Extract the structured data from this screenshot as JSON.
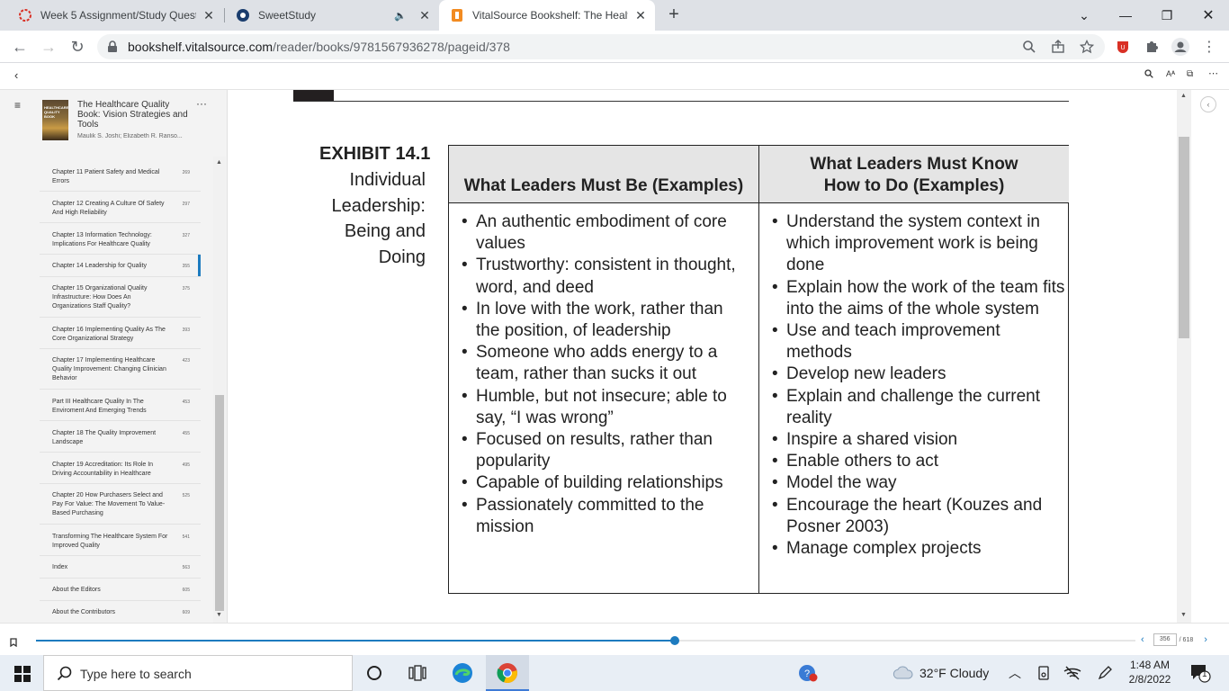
{
  "browser": {
    "tabs": [
      {
        "title": "Week 5 Assignment/Study Quest",
        "active": false,
        "favicon": "ring-icon"
      },
      {
        "title": "SweetStudy",
        "active": false,
        "favicon": "sweetstudy-icon",
        "audio": true
      },
      {
        "title": "VitalSource Bookshelf: The Healt",
        "active": true,
        "favicon": "vitalsource-icon"
      }
    ],
    "url_host": "bookshelf.vitalsource.com",
    "url_path": "/reader/books/9781567936278/pageid/378",
    "accent_color": "#1d7bbf"
  },
  "sidebar": {
    "book_title": "The Healthcare Quality Book: Vision Strategies and Tools",
    "book_authors": "Maulik S. Joshi; Elizabeth R. Ranso...",
    "cover_text": "HEALTHCARE QUALITY BOOK",
    "toc": [
      {
        "label": "Chapter 11 Patient Safety and Medical Errors",
        "page": "269"
      },
      {
        "label": "Chapter 12 Creating A Culture Of Safety And High Reliability",
        "page": "297"
      },
      {
        "label": "Chapter 13 Information Technology: Implications For Healthcare Quality",
        "page": "327"
      },
      {
        "label": "Chapter 14 Leadership for Quality",
        "page": "355",
        "active": true
      },
      {
        "label": "Chapter 15 Organizational Quality Infrastructure: How Does An Organizations Staff Quality?",
        "page": "375"
      },
      {
        "label": "Chapter 16 Implementing Quality As The Core Organizational Strategy",
        "page": "393"
      },
      {
        "label": "Chapter 17 Implementing Healthcare Quality Improvement: Changing Clinician Behavior",
        "page": "423"
      },
      {
        "label": "Part III Healthcare Quality In The Enviroment And Emerging Trends",
        "page": "453"
      },
      {
        "label": "Chapter 18 The Quality Improvement Landscape",
        "page": "455"
      },
      {
        "label": "Chapter 19 Accreditation: Its Role In Driving Accountability in Healthcare",
        "page": "495"
      },
      {
        "label": "Chapter 20 How Purchasers Select and Pay For Value: The Movement To Value-Based Purchasing",
        "page": "525"
      },
      {
        "label": "Transforming The Healthcare System For Improved Quality",
        "page": "541"
      },
      {
        "label": "Index",
        "page": "563"
      },
      {
        "label": "About the Editors",
        "page": "605"
      },
      {
        "label": "About the Contributors",
        "page": "609"
      }
    ]
  },
  "exhibit": {
    "number": "EXHIBIT 14.1",
    "caption": "Individual Leadership: Being and Doing",
    "col1_header": "What Leaders Must Be (Examples)",
    "col2_header": "What Leaders Must Know How to Do (Examples)",
    "col1_items": [
      "An authentic embodiment of core values",
      "Trustworthy: consistent in thought, word, and deed",
      "In love with the work, rather than the position, of leadership",
      "Someone who adds energy to a team, rather than sucks it out",
      "Humble, but not insecure; able to say, “I was wrong”",
      "Focused on results, rather than popularity",
      "Capable of building relationships",
      "Passionately committed to the mission"
    ],
    "col2_items": [
      "Understand the system context in which improvement work is being done",
      "Explain how the work of the team fits into the aims of the whole system",
      "Use and teach improvement methods",
      "Develop new leaders",
      "Explain and challenge the current reality",
      "Inspire a shared vision",
      "Enable others to act",
      "Model the way",
      "Encourage the heart (Kouzes and Posner 2003)",
      "Manage complex projects"
    ]
  },
  "pager": {
    "current_page": "356",
    "total_pages": "/ 618",
    "progress_fraction": 0.581
  },
  "taskbar": {
    "search_placeholder": "Type here to search",
    "weather": "32°F  Cloudy",
    "time": "1:48 AM",
    "date": "2/8/2022",
    "notification_count": "1"
  }
}
